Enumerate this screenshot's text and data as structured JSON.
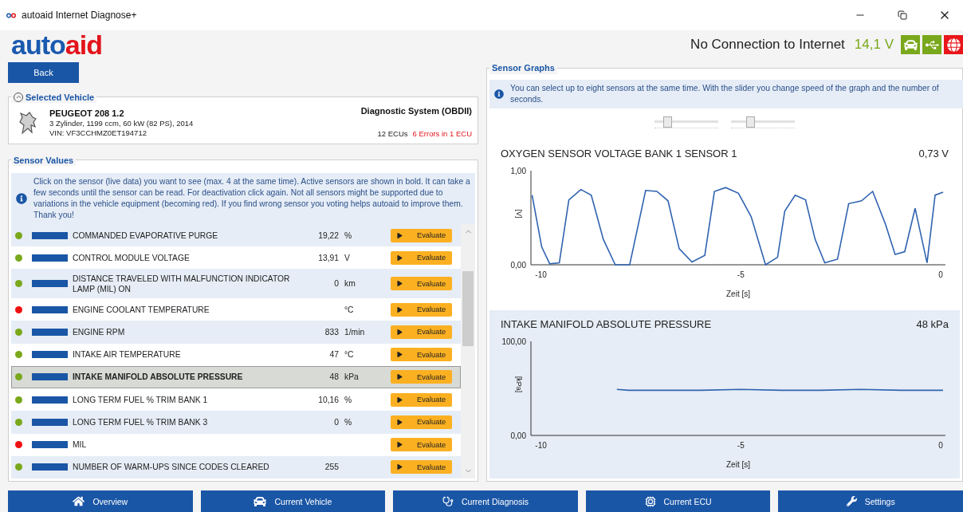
{
  "window": {
    "title": "autoaid Internet Diagnose+"
  },
  "logo": {
    "parts": [
      {
        "text": "auto",
        "color": "#1a5ab0"
      },
      {
        "text": "aid",
        "color": "#e3141c"
      }
    ]
  },
  "status": {
    "connection": "No Connection to Internet",
    "voltage": "14,1 V",
    "icons": [
      {
        "kind": "car",
        "color": "#7aa81c"
      },
      {
        "kind": "usb",
        "color": "#7aa81c"
      },
      {
        "kind": "globe",
        "color": "#e8161a"
      }
    ]
  },
  "back_button": "Back",
  "selected_vehicle": {
    "title": "Selected Vehicle",
    "expanded": true,
    "name": "PEUGEOT 208 1.2",
    "details": "3 Zylinder, 1199 ccm, 60 kW (82 PS), 2014",
    "vin": "VIN: VF3CCHMZ0ET194712",
    "system": "Diagnostic System (OBDII)",
    "ecus": "12 ECUs",
    "errors": "6 Errors in 1 ECU"
  },
  "sensor_values": {
    "title": "Sensor Values",
    "info": "Click on the sensor (live data) you want to see (max. 4 at the same time). Active sensors are shown in bold. It can take a few seconds until the sensor can be read. For deactivation click again. Not all sensors might be supported due to variations in the vehicle equipment (becoming red). If you find wrong sensor you voting helps autoaid to improve them. Thank you!",
    "rows": [
      {
        "name": "COMMANDED EVAPORATIVE PURGE",
        "value": "19,22",
        "unit": "%",
        "color": "#7aa81c",
        "selected": false,
        "button": "Evaluate"
      },
      {
        "name": "CONTROL MODULE VOLTAGE",
        "value": "13,91",
        "unit": "V",
        "color": "#7aa81c",
        "selected": false,
        "button": "Evaluate"
      },
      {
        "name": "DISTANCE TRAVELED WITH MALFUNCTION INDICATOR LAMP (MIL) ON",
        "value": "0",
        "unit": "km",
        "color": "#7aa81c",
        "selected": false,
        "button": "Evaluate"
      },
      {
        "name": "ENGINE COOLANT TEMPERATURE",
        "unit": "°C",
        "color": "#ee1111",
        "selected": false,
        "button": "Evaluate"
      },
      {
        "name": "ENGINE RPM",
        "value": "833",
        "unit": "1/min",
        "color": "#7aa81c",
        "selected": false,
        "button": "Evaluate"
      },
      {
        "name": "INTAKE AIR TEMPERATURE",
        "value": "47",
        "unit": "°C",
        "color": "#7aa81c",
        "selected": false,
        "button": "Evaluate"
      },
      {
        "name": "INTAKE MANIFOLD ABSOLUTE PRESSURE",
        "value": "48",
        "unit": "kPa",
        "color": "#7aa81c",
        "selected": true,
        "button": "Evaluate"
      },
      {
        "name": "LONG TERM FUEL % TRIM BANK 1",
        "value": "10,16",
        "unit": "%",
        "color": "#7aa81c",
        "selected": false,
        "button": "Evaluate"
      },
      {
        "name": "LONG TERM FUEL % TRIM BANK 3",
        "value": "0",
        "unit": "%",
        "color": "#7aa81c",
        "selected": false,
        "button": "Evaluate"
      },
      {
        "name": "MIL",
        "color": "#ee1111",
        "selected": false,
        "button": "Evaluate"
      },
      {
        "name": "NUMBER OF WARM-UPS SINCE CODES CLEARED",
        "value": "255",
        "color": "#7aa81c",
        "selected": false,
        "button": "Evaluate"
      }
    ]
  },
  "sensor_graphs": {
    "title": "Sensor Graphs",
    "info": "You can select up to eight sensors at the same time. With the slider you change speed of the graph and the number of seconds.",
    "sliders": [
      {
        "level": 0.2
      },
      {
        "level": 0.3
      }
    ],
    "graphs": [
      {
        "title": "OXYGEN SENSOR VOLTAGE BANK 1 SENSOR 1",
        "reading": "0,73 V",
        "chart_data": {
          "type": "line",
          "xlabel": "Zeit [s]",
          "ylabel": "[V]",
          "xlim": [
            -10.25,
            0.12
          ],
          "ylim": [
            0,
            1
          ],
          "xticks": [
            -10,
            -5,
            0
          ],
          "yticks": [
            {
              "value": 0,
              "label": "0,00"
            },
            {
              "value": 1,
              "label": "1,00"
            }
          ],
          "x": [
            -10.22,
            -9.98,
            -9.78,
            -9.54,
            -9.3,
            -9.0,
            -8.74,
            -8.44,
            -8.14,
            -7.78,
            -7.38,
            -7.1,
            -6.82,
            -6.54,
            -6.22,
            -5.9,
            -5.66,
            -5.38,
            -5.06,
            -4.74,
            -4.38,
            -4.08,
            -3.9,
            -3.64,
            -3.38,
            -3.14,
            -2.9,
            -2.58,
            -2.3,
            -1.98,
            -1.7,
            -1.38,
            -1.14,
            -0.9,
            -0.64,
            -0.34,
            -0.14,
            0.06
          ],
          "series": [
            {
              "color": "#2f63b0",
              "values": [
                0.74,
                0.19,
                0.01,
                0.02,
                0.69,
                0.8,
                0.74,
                0.27,
                0.0,
                0.0,
                0.79,
                0.78,
                0.68,
                0.17,
                0.03,
                0.1,
                0.78,
                0.82,
                0.76,
                0.51,
                0.0,
                0.08,
                0.57,
                0.74,
                0.69,
                0.27,
                0.02,
                0.06,
                0.65,
                0.68,
                0.78,
                0.43,
                0.11,
                0.14,
                0.6,
                0.02,
                0.74,
                0.77
              ]
            }
          ]
        }
      },
      {
        "title": "INTAKE MANIFOLD ABSOLUTE PRESSURE",
        "reading": "48 kPa",
        "chart_data": {
          "type": "line",
          "xlabel": "Zeit [s]",
          "ylabel": "[kPa]",
          "xlim": [
            -10.25,
            0.12
          ],
          "ylim": [
            0,
            100
          ],
          "xticks": [
            -10,
            -5,
            0
          ],
          "yticks": [
            {
              "value": 0,
              "label": "0,00"
            },
            {
              "value": 100,
              "label": "100,00"
            }
          ],
          "x": [
            -8.1,
            -7.8,
            -6,
            -5,
            -4,
            -3,
            -2,
            -1,
            0.06
          ],
          "series": [
            {
              "color": "#2f63b0",
              "values": [
                49,
                48,
                48,
                49,
                48,
                48,
                49,
                48,
                48
              ]
            }
          ]
        }
      }
    ]
  },
  "nav": [
    {
      "kind": "home",
      "label": "Overview"
    },
    {
      "kind": "car",
      "label": "Current Vehicle"
    },
    {
      "kind": "stethoscope",
      "label": "Current Diagnosis"
    },
    {
      "kind": "chip",
      "label": "Current ECU"
    },
    {
      "kind": "wrench",
      "label": "Settings"
    }
  ]
}
